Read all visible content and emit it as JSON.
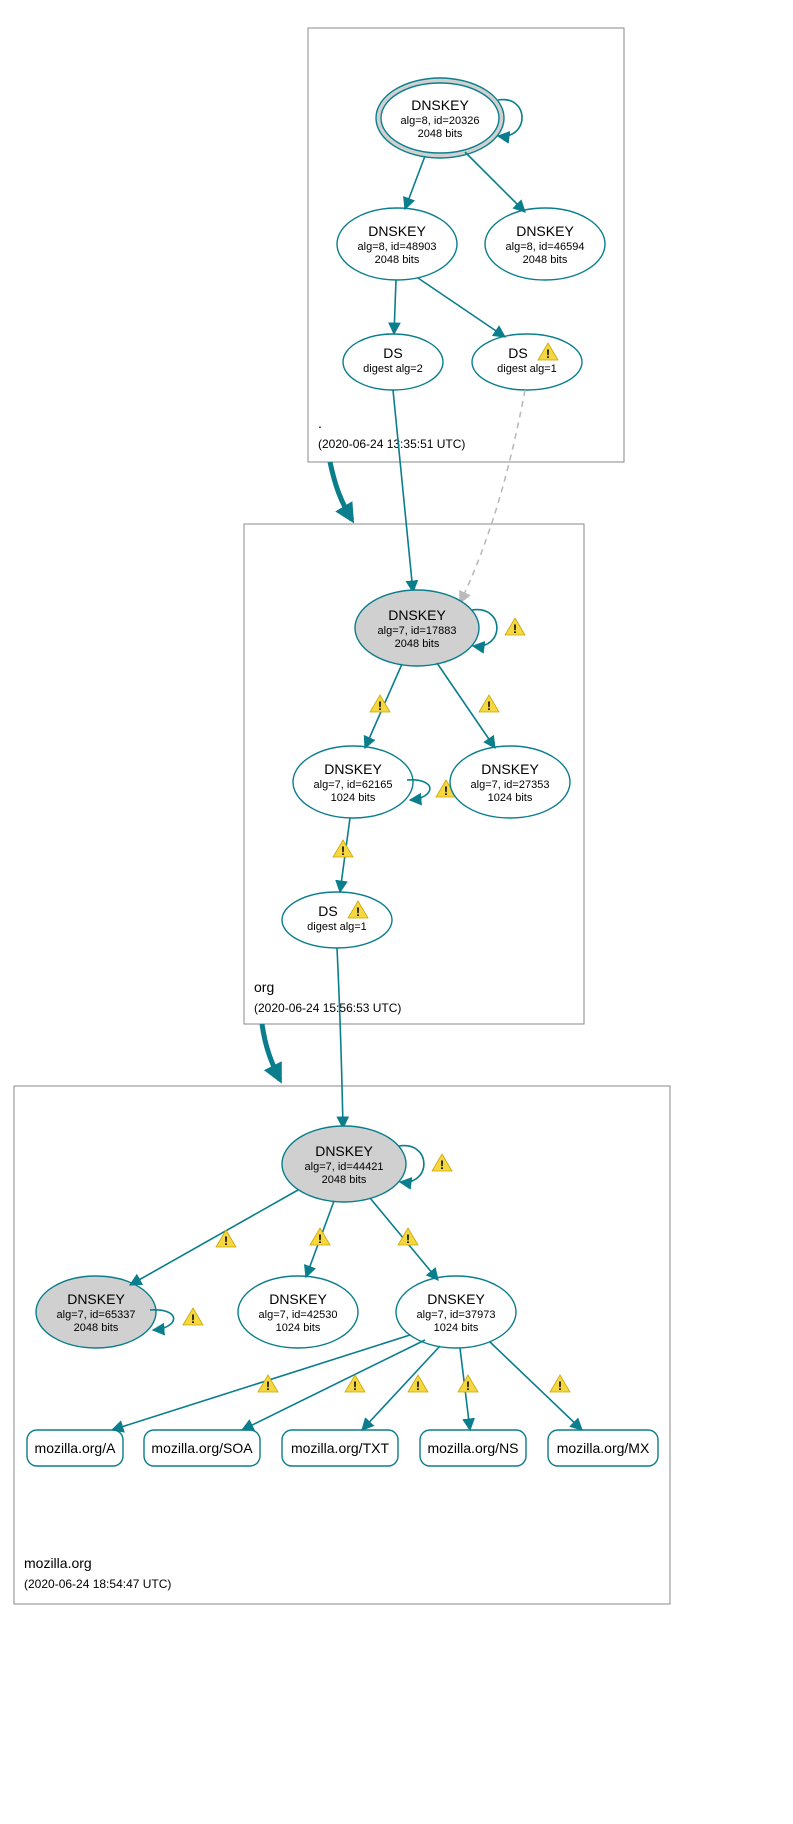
{
  "colors": {
    "edge": "#0a7e8c",
    "shaded_fill": "#d0d0d0",
    "warn_fill": "#f5d742"
  },
  "zones": {
    "root": {
      "name": ".",
      "timestamp": "(2020-06-24 13:35:51 UTC)"
    },
    "org": {
      "name": "org",
      "timestamp": "(2020-06-24 15:56:53 UTC)"
    },
    "moz": {
      "name": "mozilla.org",
      "timestamp": "(2020-06-24 18:54:47 UTC)"
    }
  },
  "nodes": {
    "root_ksk": {
      "title": "DNSKEY",
      "l1": "alg=8, id=20326",
      "l2": "2048 bits"
    },
    "root_zsk1": {
      "title": "DNSKEY",
      "l1": "alg=8, id=48903",
      "l2": "2048 bits"
    },
    "root_zsk2": {
      "title": "DNSKEY",
      "l1": "alg=8, id=46594",
      "l2": "2048 bits"
    },
    "root_ds2": {
      "title": "DS",
      "l1": "digest alg=2"
    },
    "root_ds1": {
      "title": "DS",
      "l1": "digest alg=1"
    },
    "org_ksk": {
      "title": "DNSKEY",
      "l1": "alg=7, id=17883",
      "l2": "2048 bits"
    },
    "org_zsk1": {
      "title": "DNSKEY",
      "l1": "alg=7, id=62165",
      "l2": "1024 bits"
    },
    "org_zsk2": {
      "title": "DNSKEY",
      "l1": "alg=7, id=27353",
      "l2": "1024 bits"
    },
    "org_ds1": {
      "title": "DS",
      "l1": "digest alg=1"
    },
    "moz_ksk": {
      "title": "DNSKEY",
      "l1": "alg=7, id=44421",
      "l2": "2048 bits"
    },
    "moz_zsk1": {
      "title": "DNSKEY",
      "l1": "alg=7, id=65337",
      "l2": "2048 bits"
    },
    "moz_zsk2": {
      "title": "DNSKEY",
      "l1": "alg=7, id=42530",
      "l2": "1024 bits"
    },
    "moz_zsk3": {
      "title": "DNSKEY",
      "l1": "alg=7, id=37973",
      "l2": "1024 bits"
    },
    "rr_a": {
      "label": "mozilla.org/A"
    },
    "rr_soa": {
      "label": "mozilla.org/SOA"
    },
    "rr_txt": {
      "label": "mozilla.org/TXT"
    },
    "rr_ns": {
      "label": "mozilla.org/NS"
    },
    "rr_mx": {
      "label": "mozilla.org/MX"
    }
  }
}
